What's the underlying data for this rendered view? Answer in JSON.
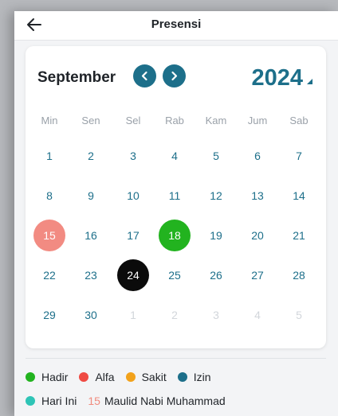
{
  "header": {
    "title": "Presensi",
    "back_icon": "arrow-left-icon"
  },
  "calendar": {
    "month": "September",
    "year": "2024",
    "weekdays": [
      "Min",
      "Sen",
      "Sel",
      "Rab",
      "Kam",
      "Jum",
      "Sab"
    ],
    "weeks": [
      [
        {
          "d": "1"
        },
        {
          "d": "2"
        },
        {
          "d": "3"
        },
        {
          "d": "4"
        },
        {
          "d": "5"
        },
        {
          "d": "6"
        },
        {
          "d": "7"
        }
      ],
      [
        {
          "d": "8"
        },
        {
          "d": "9"
        },
        {
          "d": "10"
        },
        {
          "d": "11"
        },
        {
          "d": "12"
        },
        {
          "d": "13"
        },
        {
          "d": "14"
        }
      ],
      [
        {
          "d": "15",
          "status": "holiday"
        },
        {
          "d": "16"
        },
        {
          "d": "17"
        },
        {
          "d": "18",
          "status": "hadir"
        },
        {
          "d": "19"
        },
        {
          "d": "20"
        },
        {
          "d": "21"
        }
      ],
      [
        {
          "d": "22"
        },
        {
          "d": "23"
        },
        {
          "d": "24",
          "status": "today"
        },
        {
          "d": "25"
        },
        {
          "d": "26"
        },
        {
          "d": "27"
        },
        {
          "d": "28"
        }
      ],
      [
        {
          "d": "29"
        },
        {
          "d": "30"
        },
        {
          "d": "1",
          "muted": true
        },
        {
          "d": "2",
          "muted": true
        },
        {
          "d": "3",
          "muted": true
        },
        {
          "d": "4",
          "muted": true
        },
        {
          "d": "5",
          "muted": true
        }
      ]
    ]
  },
  "legend": {
    "items": [
      {
        "label": "Hadir",
        "color": "#22b31f"
      },
      {
        "label": "Alfa",
        "color": "#ef4a43"
      },
      {
        "label": "Sakit",
        "color": "#f2a21b"
      },
      {
        "label": "Izin",
        "color": "#1d6f8a"
      }
    ],
    "today": {
      "label": "Hari Ini",
      "color": "#2ec4b6"
    },
    "holiday": {
      "day": "15",
      "label": "Maulid Nabi Muhammad"
    }
  }
}
